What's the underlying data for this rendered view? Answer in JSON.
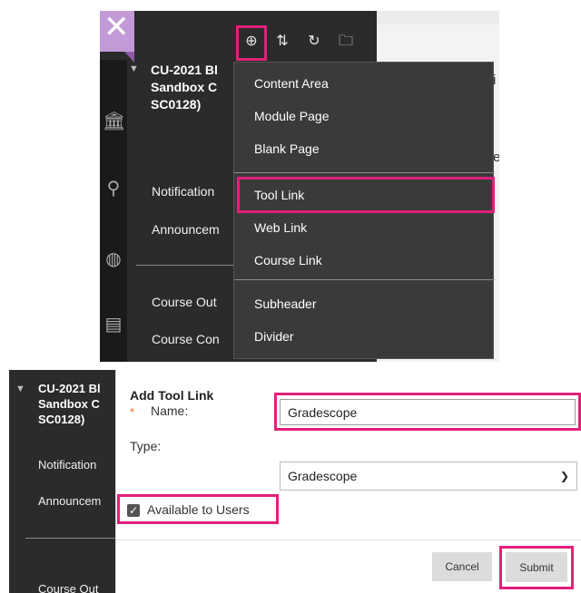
{
  "top": {
    "close_glyph": "✕",
    "toolbar_icons": {
      "add": "⊕",
      "reorder": "⇅",
      "refresh": "↻",
      "folder": "🗀"
    },
    "course": {
      "title_line1": "CU-2021 Bl",
      "title_line2": "Sandbox C",
      "title_line3": "SC0128)"
    },
    "nav": {
      "notifications": "Notification",
      "announcements": "Announcem",
      "course_outline": "Course Out",
      "course_content": "Course Con"
    },
    "dropdown": {
      "items": [
        "Content Area",
        "Module Page",
        "Blank Page",
        "Tool Link",
        "Web Link",
        "Course Link",
        "Subheader",
        "Divider"
      ]
    },
    "peek": {
      "a": "i",
      "b": "e"
    }
  },
  "bottom": {
    "course": {
      "title_line1": "CU-2021 Bl",
      "title_line2": "Sandbox C",
      "title_line3": "SC0128)"
    },
    "nav": {
      "notifications": "Notification",
      "announcements": "Announcem",
      "course_outline": "Course Out"
    },
    "form": {
      "title": "Add Tool Link",
      "required_mark": "*",
      "name_label": "Name:",
      "name_value": "Gradescope",
      "type_label": "Type:",
      "type_value": "Gradescope",
      "available_label": "Available to Users",
      "available_checked": true,
      "cancel_label": "Cancel",
      "submit_label": "Submit"
    }
  },
  "colors": {
    "highlight": "#e0217a",
    "sidebar_bg": "#2b2b2b",
    "dropdown_bg": "#3a3a3a",
    "accent_purple": "#c39ad8",
    "required_star": "#e8731e"
  }
}
